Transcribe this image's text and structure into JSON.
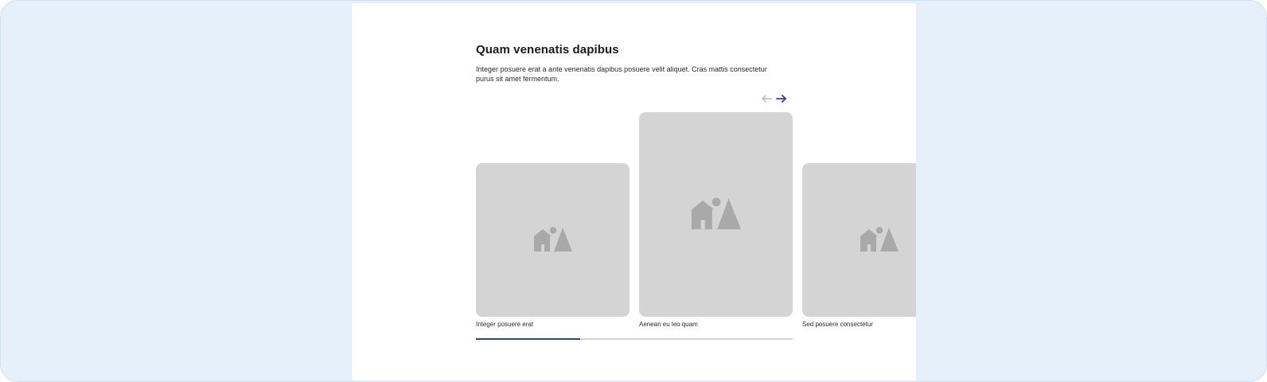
{
  "section": {
    "title": "Quam venenatis dapibus",
    "description": "Integer posuere erat a ante venenatis dapibus posuere velit aliquet. Cras mattis consectetur purus sit amet fermentum."
  },
  "carousel": {
    "cards": [
      {
        "caption": "Integer posuere erat",
        "icon": "image-placeholder-icon"
      },
      {
        "caption": "Aenean eu leo quam",
        "icon": "image-placeholder-icon"
      },
      {
        "caption": "Sed posuere consectetur",
        "icon": "image-placeholder-icon"
      }
    ],
    "prev_icon": "arrow-left-icon",
    "next_icon": "arrow-right-icon",
    "progress": 0.33
  },
  "colors": {
    "page_background": "#e6f0fa",
    "placeholder": "#d4d4d4",
    "placeholder_icon": "#a9a9a9",
    "accent": "#2f3ea8",
    "arrow_disabled": "#b8b8b8"
  }
}
